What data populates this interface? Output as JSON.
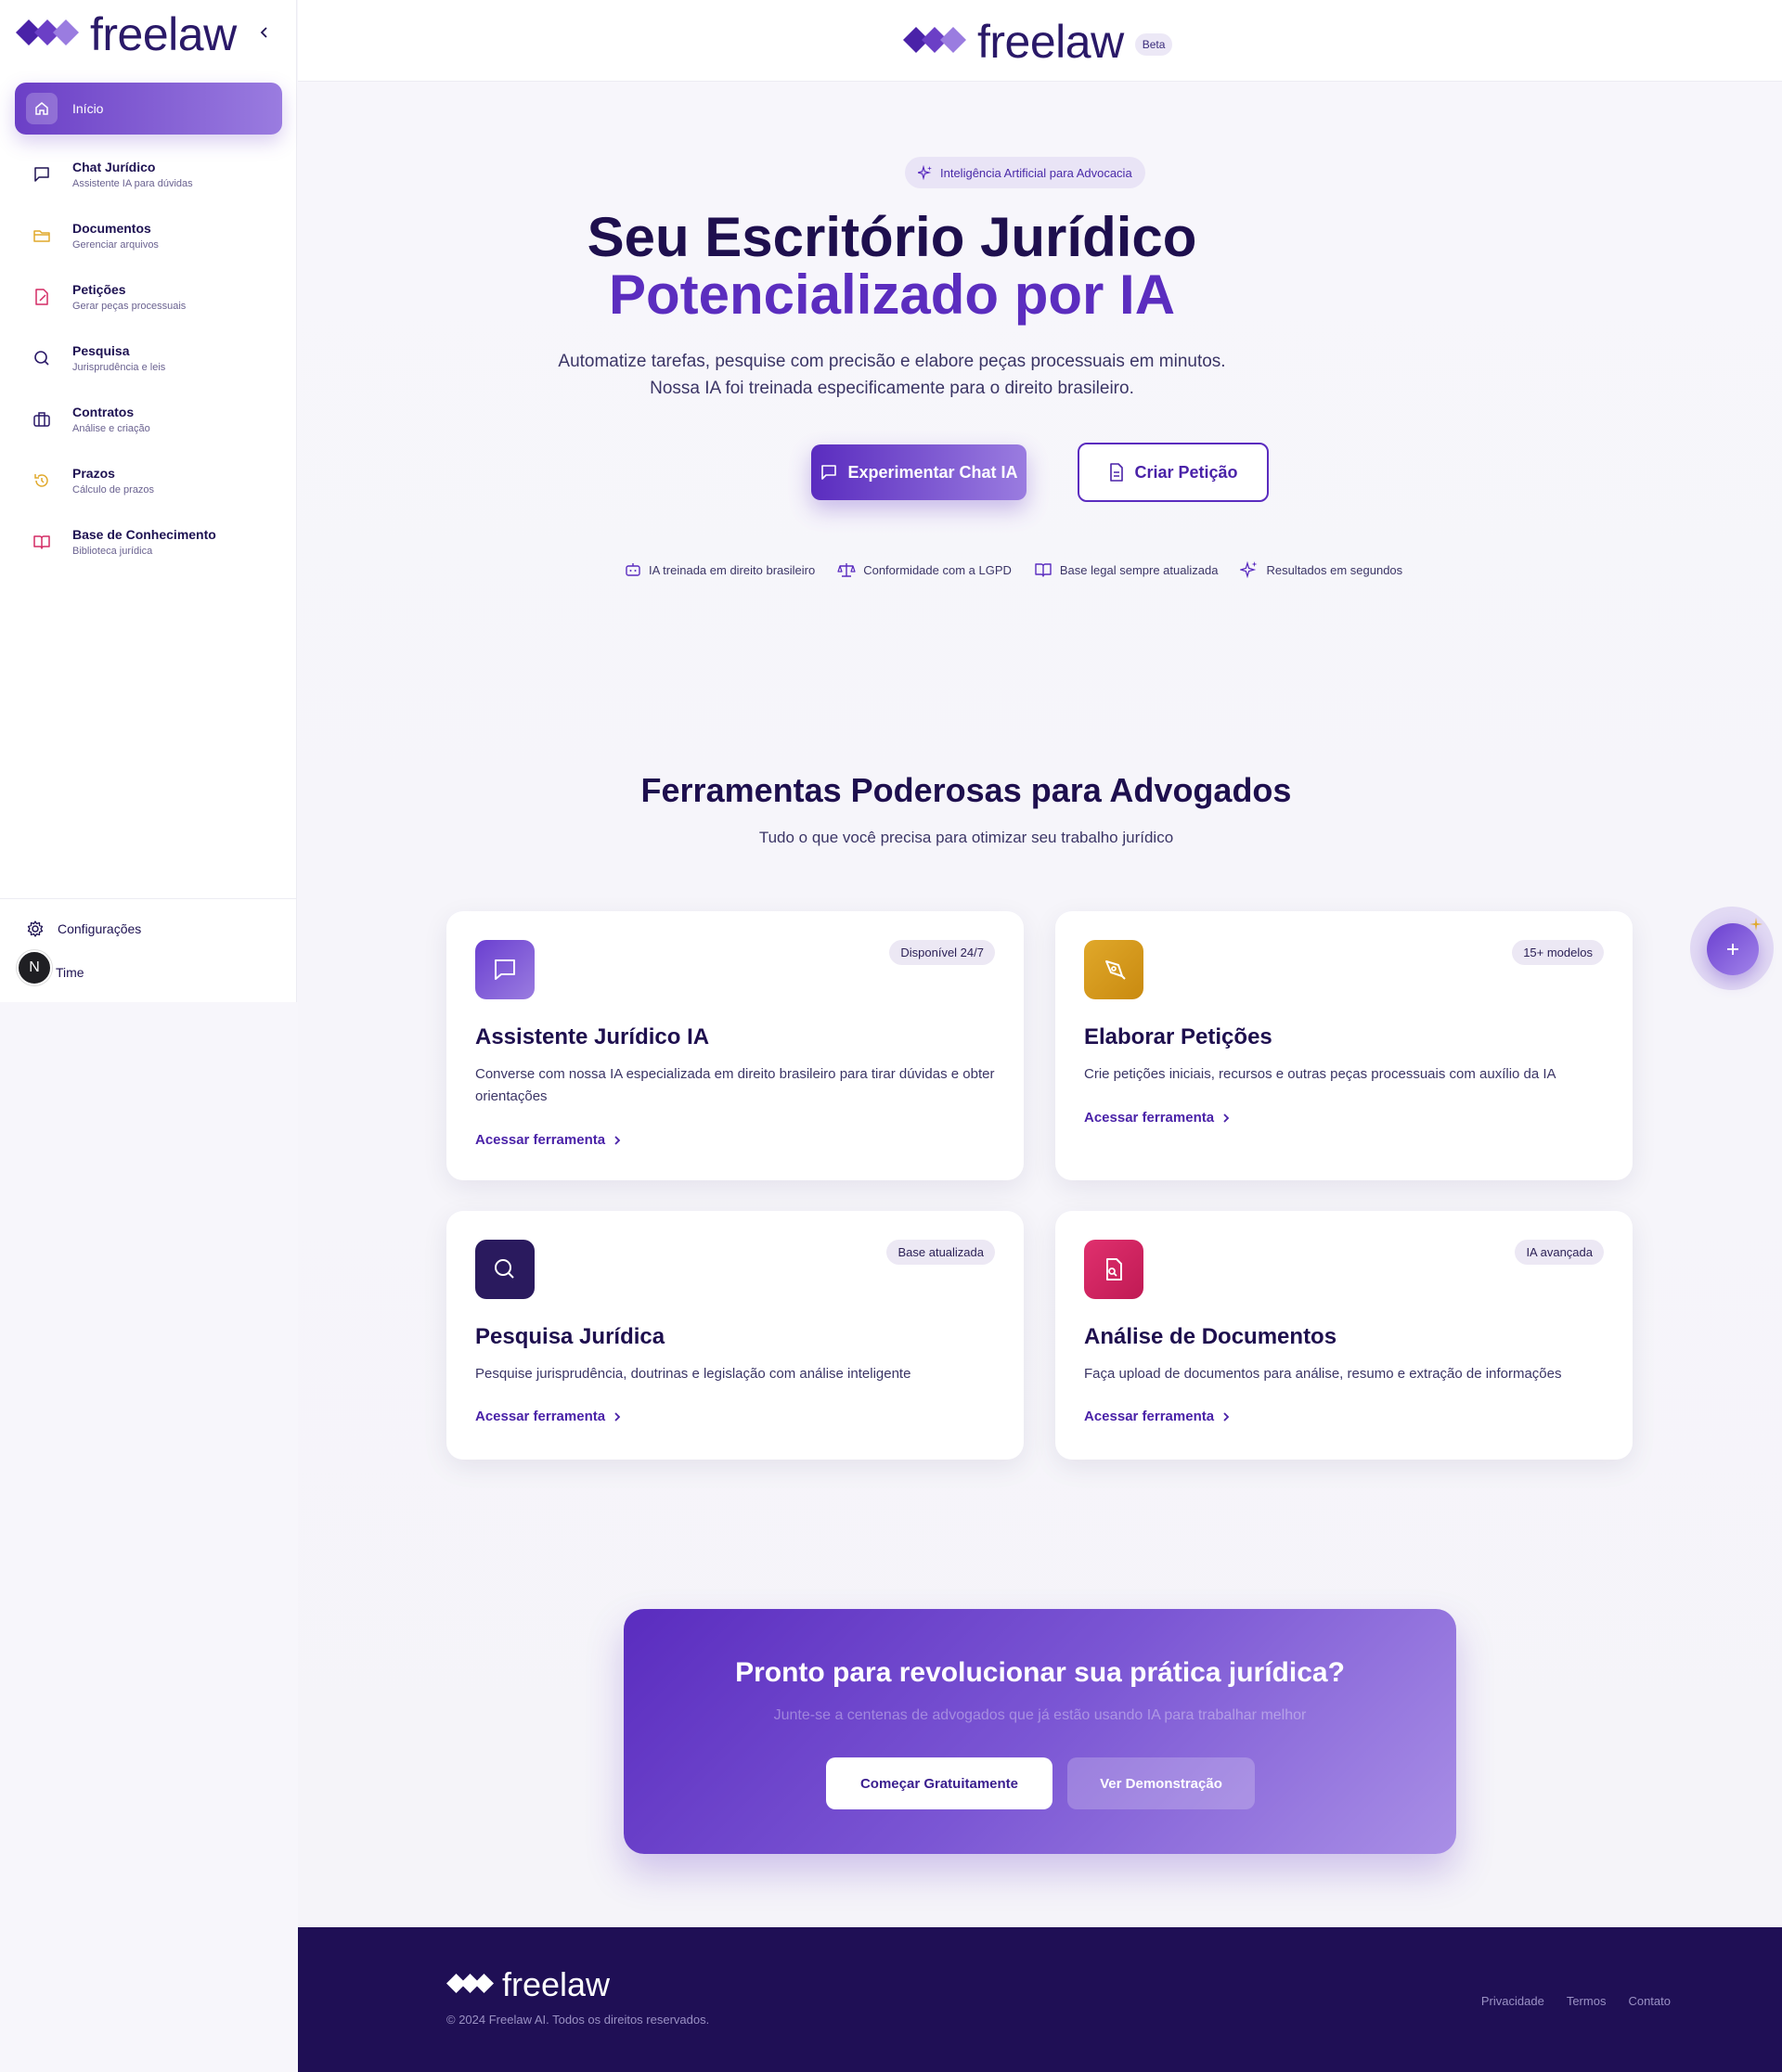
{
  "sidebar": {
    "brand": "freelaw",
    "items": [
      {
        "label": "Início",
        "sub": ""
      },
      {
        "label": "Chat Jurídico",
        "sub": "Assistente IA para dúvidas"
      },
      {
        "label": "Documentos",
        "sub": "Gerenciar arquivos"
      },
      {
        "label": "Petições",
        "sub": "Gerar peças processuais"
      },
      {
        "label": "Pesquisa",
        "sub": "Jurisprudência e leis"
      },
      {
        "label": "Contratos",
        "sub": "Análise e criação"
      },
      {
        "label": "Prazos",
        "sub": "Cálculo de prazos"
      },
      {
        "label": "Base de Conhecimento",
        "sub": "Biblioteca jurídica"
      }
    ],
    "settings": "Configurações",
    "team": "Time",
    "avatar_letter": "N"
  },
  "header": {
    "brand": "freelaw",
    "badge": "Beta"
  },
  "hero": {
    "pill": "Inteligência Artificial para Advocacia",
    "title_plain": "Seu Escritório Jurídico ",
    "title_accent": "Potencializado por IA",
    "subtitle_line1": "Automatize tarefas, pesquise com precisão e elabore peças processuais em minutos.",
    "subtitle_line2": "Nossa IA foi treinada especificamente para o direito brasileiro.",
    "primary_button": "Experimentar Chat IA",
    "secondary_button": "Criar Petição",
    "features": [
      "IA treinada em direito brasileiro",
      "Conformidade com a LGPD",
      "Base legal sempre atualizada",
      "Resultados em segundos"
    ]
  },
  "tools": {
    "title": "Ferramentas Poderosas para Advogados",
    "subtitle": "Tudo o que você precisa para otimizar seu trabalho jurídico",
    "link_label": "Acessar ferramenta",
    "cards": [
      {
        "title": "Assistente Jurídico IA",
        "badge": "Disponível 24/7",
        "desc": "Converse com nossa IA especializada em direito brasileiro para tirar dúvidas e obter orientações"
      },
      {
        "title": "Elaborar Petições",
        "badge": "15+ modelos",
        "desc": "Crie petições iniciais, recursos e outras peças processuais com auxílio da IA"
      },
      {
        "title": "Pesquisa Jurídica",
        "badge": "Base atualizada",
        "desc": "Pesquise jurisprudência, doutrinas e legislação com análise inteligente"
      },
      {
        "title": "Análise de Documentos",
        "badge": "IA avançada",
        "desc": "Faça upload de documentos para análise, resumo e extração de informações"
      }
    ]
  },
  "cta": {
    "title": "Pronto para revolucionar sua prática jurídica?",
    "subtitle": "Junte-se a centenas de advogados que já estão usando IA para trabalhar melhor",
    "primary": "Começar Gratuitamente",
    "secondary": "Ver Demonstração"
  },
  "footer": {
    "brand": "freelaw",
    "copyright": "© 2024 Freelaw AI. Todos os direitos reservados.",
    "links": [
      "Privacidade",
      "Termos",
      "Contato"
    ]
  },
  "colors": {
    "brand": "#5a2cbf",
    "dark": "#1e0f4e",
    "footer": "#1f0f55"
  }
}
